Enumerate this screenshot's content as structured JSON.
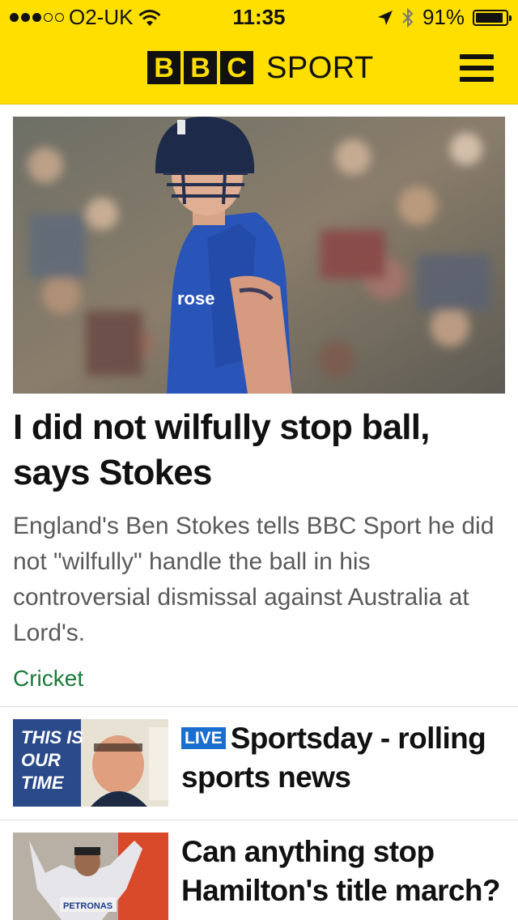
{
  "status_bar": {
    "carrier": "O2-UK",
    "time": "11:35",
    "battery_percent": "91%",
    "signal_bars_filled": 3,
    "signal_bars_total": 5,
    "battery_level": 0.91
  },
  "header": {
    "logo_letters": [
      "B",
      "B",
      "C"
    ],
    "logo_word": "SPORT",
    "menu_icon": "hamburger-menu-icon",
    "background_color": "#ffdf00"
  },
  "hero": {
    "title": "I did not wilfully stop ball, says Stokes",
    "summary": "England's Ben Stokes tells BBC Sport he did not \"wilfully\" handle the ball in his controversial dismissal against Australia at Lord's.",
    "tag": "Cricket",
    "tag_color": "#1b7a3a"
  },
  "stories": [
    {
      "live_badge": "LIVE",
      "title": "Sportsday - rolling sports news"
    },
    {
      "title": "Can anything stop Hamilton's title march?"
    }
  ],
  "colors": {
    "brand_yellow": "#ffdf00",
    "live_blue": "#1a6ecf",
    "text": "#111111",
    "summary_text": "#5a5a5a"
  }
}
